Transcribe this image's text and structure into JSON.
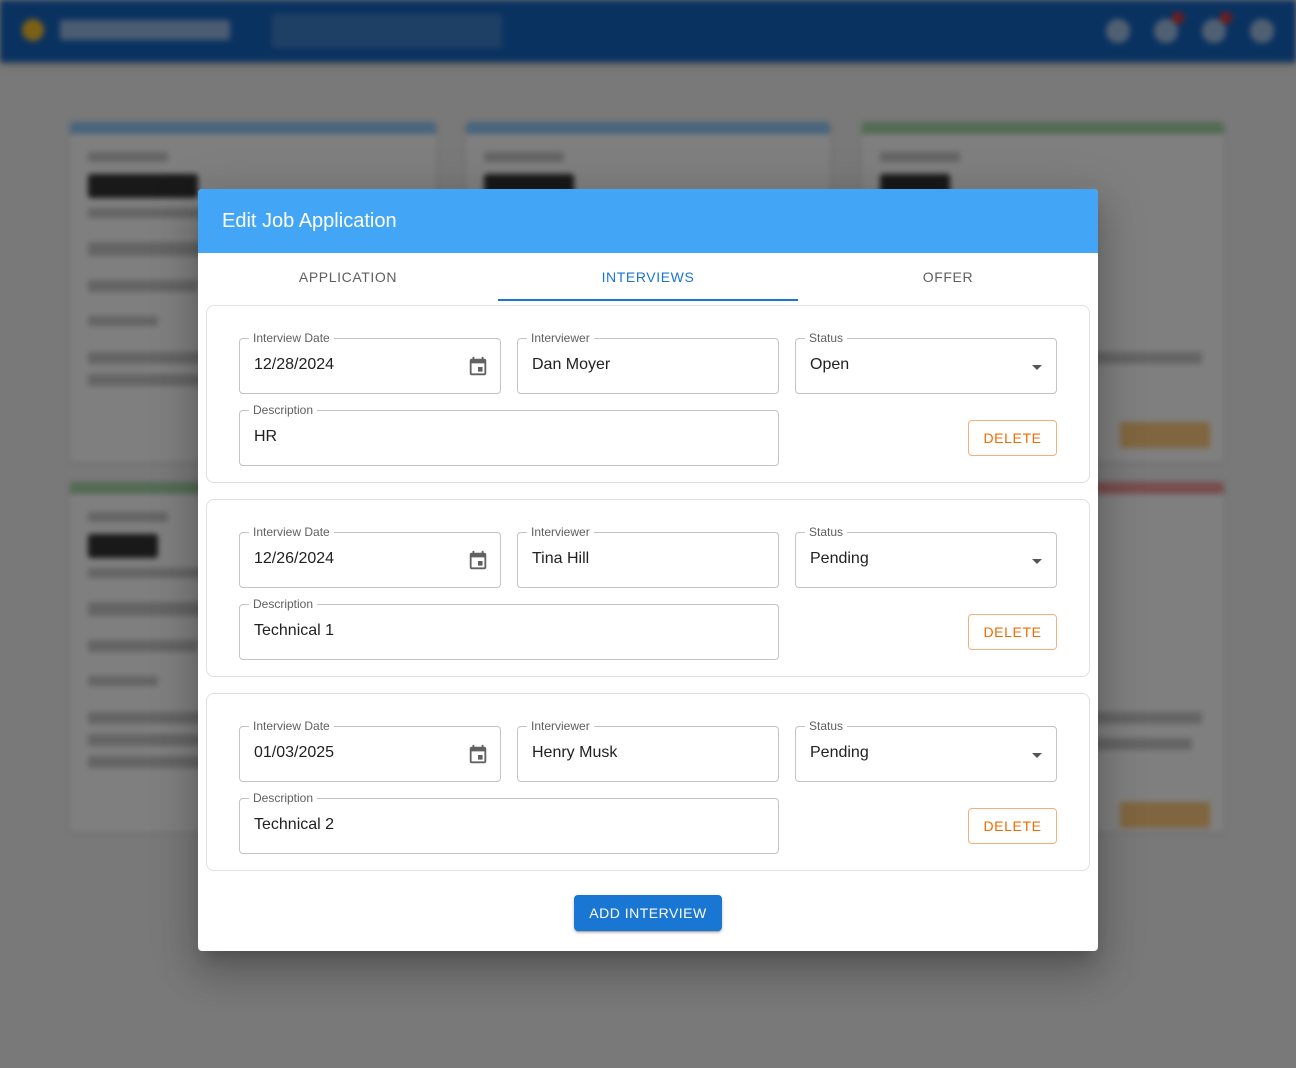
{
  "dialog": {
    "title": "Edit Job Application",
    "tabs": [
      {
        "label": "APPLICATION",
        "active": false
      },
      {
        "label": "INTERVIEWS",
        "active": true
      },
      {
        "label": "OFFER",
        "active": false
      }
    ],
    "interviews": [
      {
        "date_label": "Interview Date",
        "date": "12/28/2024",
        "interviewer_label": "Interviewer",
        "interviewer": "Dan Moyer",
        "status_label": "Status",
        "status": "Open",
        "description_label": "Description",
        "description": "HR",
        "delete_label": "DELETE"
      },
      {
        "date_label": "Interview Date",
        "date": "12/26/2024",
        "interviewer_label": "Interviewer",
        "interviewer": "Tina Hill",
        "status_label": "Status",
        "status": "Pending",
        "description_label": "Description",
        "description": "Technical 1",
        "delete_label": "DELETE"
      },
      {
        "date_label": "Interview Date",
        "date": "01/03/2025",
        "interviewer_label": "Interviewer",
        "interviewer": "Henry Musk",
        "status_label": "Status",
        "status": "Pending",
        "description_label": "Description",
        "description": "Technical 2",
        "delete_label": "DELETE"
      }
    ],
    "add_interview_label": "ADD INTERVIEW"
  },
  "colors": {
    "header": "#42a5f5",
    "primary": "#1976d2",
    "delete": "#ef6c00",
    "appbar": "#1565c0"
  },
  "icons": {
    "date_picker": "calendar-icon",
    "status_dropdown": "arrow-drop-down-icon"
  }
}
